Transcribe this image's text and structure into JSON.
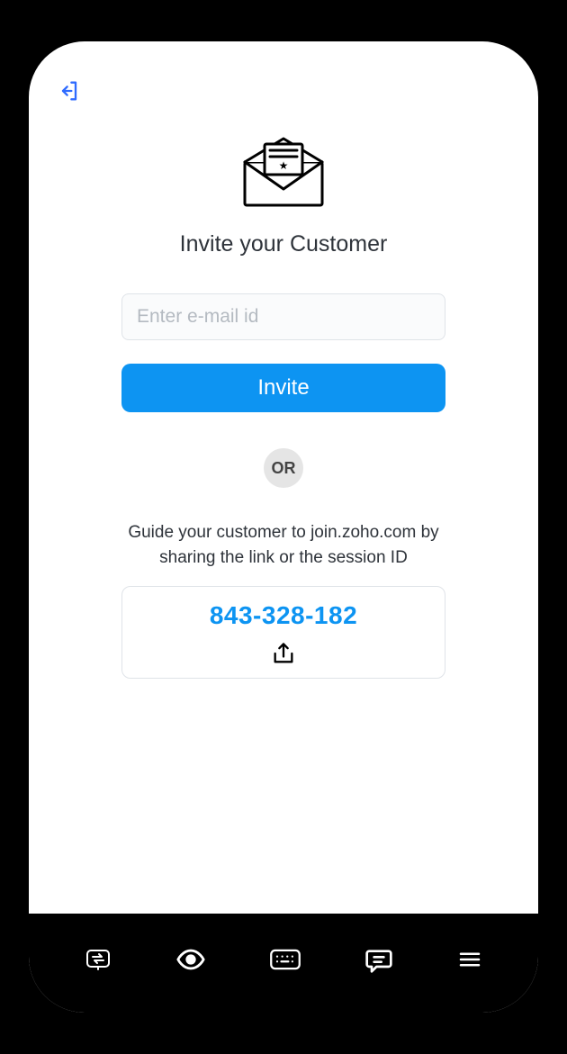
{
  "header": {
    "back_name": "back"
  },
  "invite": {
    "title": "Invite your Customer",
    "email_placeholder": "Enter e-mail id",
    "invite_button_label": "Invite",
    "or_label": "OR",
    "guide_text": "Guide your customer to join.zoho.com by sharing the link or the session ID",
    "session_id": "843-328-182"
  },
  "bottombar": {
    "items": [
      {
        "name": "swap"
      },
      {
        "name": "view"
      },
      {
        "name": "keyboard"
      },
      {
        "name": "chat"
      },
      {
        "name": "menu"
      }
    ]
  },
  "colors": {
    "accent": "#0d94f2"
  }
}
